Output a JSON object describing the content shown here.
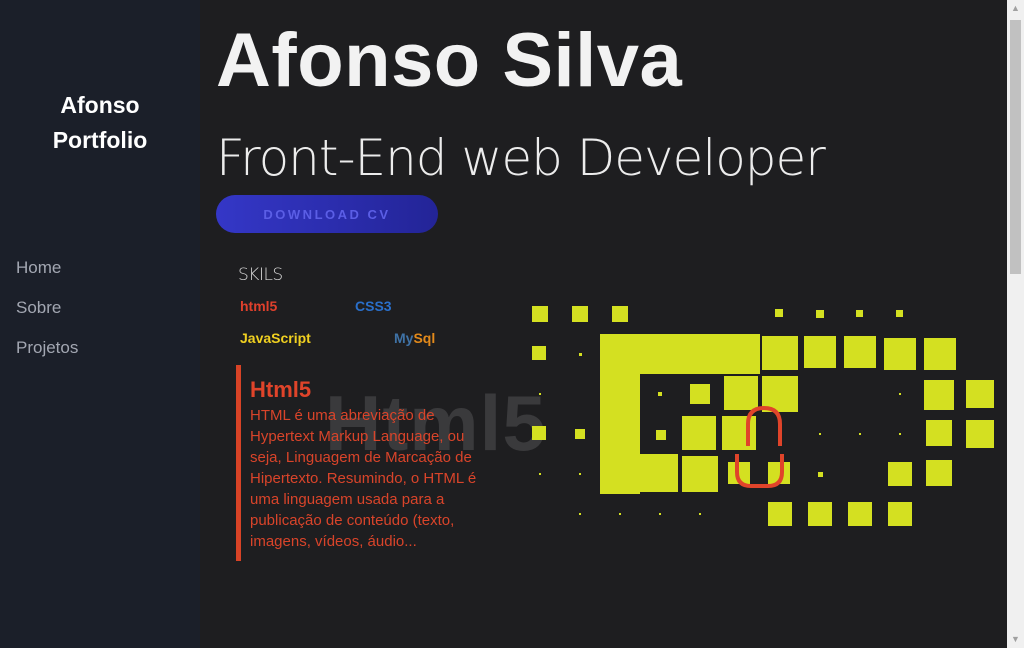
{
  "sidebar": {
    "brand_line1": "Afonso",
    "brand_line2": "Portfolio",
    "nav": [
      {
        "label": "Home"
      },
      {
        "label": "Sobre"
      },
      {
        "label": "Projetos"
      }
    ]
  },
  "hero": {
    "name": "Afonso Silva",
    "role": "Front-End web Developer",
    "cv_button": "DOWNLOAD CV"
  },
  "skills": {
    "title": "SKILS",
    "items": {
      "html": "html5",
      "css": "CSS3",
      "js": "JavaScript",
      "mysql_my": "My",
      "mysql_sql": "Sql"
    }
  },
  "detail": {
    "watermark": "Html5",
    "title": "Html5",
    "text": "HTML é uma abreviação de Hypertext Markup Language, ou seja, Linguagem de Marcação de Hipertexto. Resumindo, o HTML é uma linguagem usada para a publicação de conteúdo (texto, imagens, vídeos, áudio..."
  },
  "colors": {
    "accent_green": "#d4e021",
    "accent_red": "#e0442a",
    "button_blue": "#3437c7"
  }
}
